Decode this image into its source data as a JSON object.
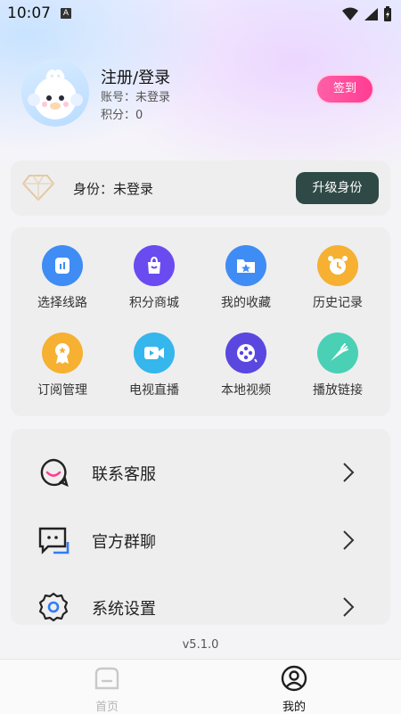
{
  "status_bar": {
    "time": "10:07",
    "notification_badge": "A"
  },
  "profile": {
    "title": "注册/登录",
    "account": "账号：未登录",
    "points": "积分：0",
    "signin_label": "签到"
  },
  "identity": {
    "label": "身份：未登录",
    "upgrade_label": "升级身份"
  },
  "grid": [
    {
      "label": "选择线路",
      "color": "#3f8cf4",
      "icon": "route-icon"
    },
    {
      "label": "积分商城",
      "color": "#6a4bf0",
      "icon": "shopping-bag-icon"
    },
    {
      "label": "我的收藏",
      "color": "#3f8cf4",
      "icon": "folder-star-icon"
    },
    {
      "label": "历史记录",
      "color": "#f6b032",
      "icon": "clock-icon"
    },
    {
      "label": "订阅管理",
      "color": "#f6b032",
      "icon": "medal-icon"
    },
    {
      "label": "电视直播",
      "color": "#35b6ec",
      "icon": "video-camera-icon"
    },
    {
      "label": "本地视频",
      "color": "#5a47e0",
      "icon": "film-reel-icon"
    },
    {
      "label": "播放链接",
      "color": "#4ad0b4",
      "icon": "carrot-icon"
    }
  ],
  "menu": [
    {
      "label": "联系客服",
      "icon": "smile-chat-icon"
    },
    {
      "label": "官方群聊",
      "icon": "group-chat-icon"
    },
    {
      "label": "系统设置",
      "icon": "gear-icon"
    }
  ],
  "version": "v5.1.0",
  "nav": {
    "home_label": "首页",
    "mine_label": "我的"
  },
  "colors": {
    "accent_pink": "#ff3d92",
    "upgrade_bg": "#2f4a46"
  }
}
